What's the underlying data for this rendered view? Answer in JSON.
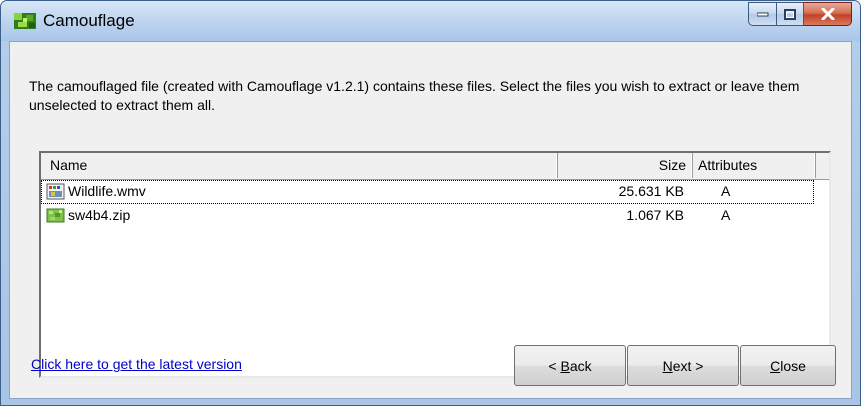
{
  "window": {
    "title": "Camouflage",
    "icon": "camouflage-app-icon",
    "accent_color": "#a9c6ea",
    "close_color": "#c2412a"
  },
  "intro": {
    "text": "The camouflaged file (created with Camouflage v1.2.1) contains these files.  Select the files you wish to extract or leave them unselected to extract them all."
  },
  "list": {
    "columns": {
      "name": "Name",
      "size": "Size",
      "attributes": "Attributes"
    },
    "rows": [
      {
        "icon": "video-file-icon",
        "name": "Wildlife.wmv",
        "size": "25.631 KB",
        "attributes": "A"
      },
      {
        "icon": "zip-file-icon",
        "name": "sw4b4.zip",
        "size": "1.067 KB",
        "attributes": "A"
      }
    ]
  },
  "footer": {
    "link_text": "Click here to get the latest version",
    "back": {
      "prefix": "< ",
      "mnemonic": "B",
      "rest": "ack"
    },
    "next": {
      "mnemonic": "N",
      "rest": "ext >"
    },
    "close": {
      "mnemonic": "C",
      "rest": "lose"
    }
  }
}
